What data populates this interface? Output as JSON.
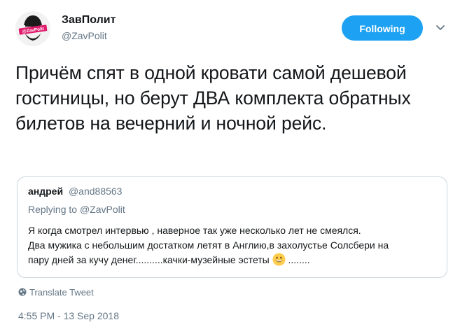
{
  "author": {
    "display_name": "ЗавПолит",
    "handle": "@ZavPolit",
    "avatar_text": "@ZavPolit"
  },
  "follow_button": {
    "label": "Following"
  },
  "tweet": {
    "text": "Причём спят в одной кровати самой дешевой гостиницы, но берут ДВА комплекта обратных билетов на вечерний и ночной рейс."
  },
  "quote": {
    "name": "андрей",
    "handle": "@and88563",
    "replying_prefix": "Replying to",
    "replying_to": "@ZavPolit",
    "line1": "Я когда смотрел интервью , наверное так уже несколько лет не смеялся.",
    "line2": "Два мужика с небольшим достатком летят в Англию,в захолустье Солсбери на",
    "line3_before": "пару дней за кучу денег..........качки-музейные эстеты",
    "line3_after": "........",
    "emoji": "grinning-face"
  },
  "translate_label": "Translate Tweet",
  "timestamp": "4:55 PM - 13 Sep 2018",
  "colors": {
    "accent": "#1da1f2",
    "secondary_text": "#657786",
    "border": "#ccd6dd"
  }
}
